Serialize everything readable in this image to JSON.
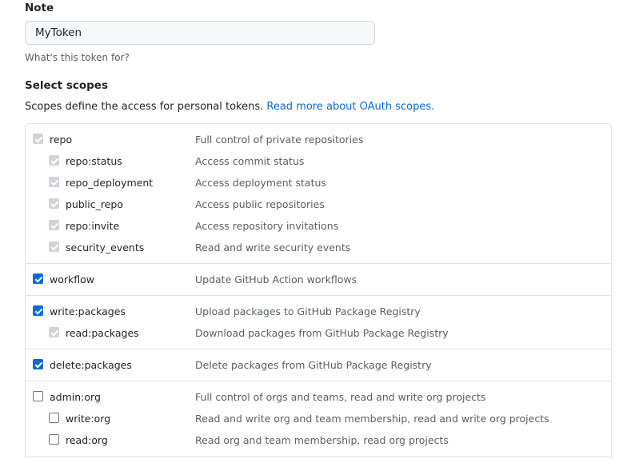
{
  "note": {
    "label": "Note",
    "value": "MyToken",
    "hint": "What's this token for?"
  },
  "scopes": {
    "title": "Select scopes",
    "description": "Scopes define the access for personal tokens. ",
    "link_text": "Read more about OAuth scopes.",
    "accent_color": "#0969da",
    "groups": [
      {
        "parent": {
          "name": "repo",
          "desc": "Full control of private repositories",
          "state": "checked-disabled"
        },
        "children": [
          {
            "name": "repo:status",
            "desc": "Access commit status",
            "state": "checked-disabled"
          },
          {
            "name": "repo_deployment",
            "desc": "Access deployment status",
            "state": "checked-disabled"
          },
          {
            "name": "public_repo",
            "desc": "Access public repositories",
            "state": "checked-disabled"
          },
          {
            "name": "repo:invite",
            "desc": "Access repository invitations",
            "state": "checked-disabled"
          },
          {
            "name": "security_events",
            "desc": "Read and write security events",
            "state": "checked-disabled"
          }
        ]
      },
      {
        "parent": {
          "name": "workflow",
          "desc": "Update GitHub Action workflows",
          "state": "checked"
        },
        "children": []
      },
      {
        "parent": {
          "name": "write:packages",
          "desc": "Upload packages to GitHub Package Registry",
          "state": "checked"
        },
        "children": [
          {
            "name": "read:packages",
            "desc": "Download packages from GitHub Package Registry",
            "state": "checked-disabled"
          }
        ]
      },
      {
        "parent": {
          "name": "delete:packages",
          "desc": "Delete packages from GitHub Package Registry",
          "state": "checked"
        },
        "children": []
      },
      {
        "parent": {
          "name": "admin:org",
          "desc": "Full control of orgs and teams, read and write org projects",
          "state": "unchecked"
        },
        "children": [
          {
            "name": "write:org",
            "desc": "Read and write org and team membership, read and write org projects",
            "state": "unchecked"
          },
          {
            "name": "read:org",
            "desc": "Read org and team membership, read org projects",
            "state": "unchecked"
          }
        ]
      }
    ]
  }
}
